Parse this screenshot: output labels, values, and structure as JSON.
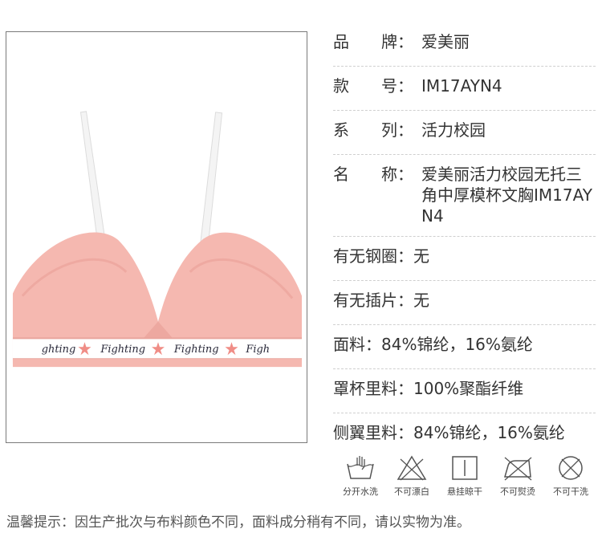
{
  "specs": [
    {
      "label": "品　　牌：",
      "value": "爱美丽"
    },
    {
      "label": "款　　号：",
      "value": "IM17AYN4"
    },
    {
      "label": "系　　列：",
      "value": "活力校园"
    },
    {
      "label": "名　　称：",
      "value": "爱美丽活力校园无托三角中厚模杯文胸IM17AYN4"
    },
    {
      "label": "有无钢圈：",
      "value": "无"
    },
    {
      "label": "有无插片：",
      "value": "无"
    },
    {
      "label": "面料：",
      "value": "84%锦纶，16%氨纶"
    },
    {
      "label": "罩杯里料：",
      "value": "100%聚酯纤维"
    },
    {
      "label": "侧翼里料：",
      "value": "84%锦纶，16%氨纶"
    }
  ],
  "care": [
    {
      "icon": "hand-wash-icon",
      "label": "分开水洗"
    },
    {
      "icon": "no-bleach-icon",
      "label": "不可漂白"
    },
    {
      "icon": "line-dry-icon",
      "label": "悬挂晾干"
    },
    {
      "icon": "no-iron-icon",
      "label": "不可熨烫"
    },
    {
      "icon": "no-dry-clean-icon",
      "label": "不可干洗"
    }
  ],
  "band_text": "Fighting",
  "note": "温馨提示：因生产批次与布料颜色不同，面料成分稍有不同，请以实物为准。",
  "colors": {
    "fabric_pink": "#f5b8b0",
    "strap": "#f3f3f3",
    "band_white": "#ffffff",
    "star_pink": "#f08d86"
  }
}
